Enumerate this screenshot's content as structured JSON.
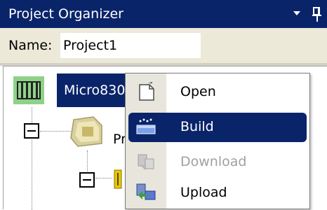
{
  "title_bar": {
    "title": "Project Organizer",
    "dropdown_icon": "chevron-down-icon",
    "pin_icon": "pin-icon"
  },
  "header": {
    "name_label": "Name:",
    "name_value": "Project1"
  },
  "tree": {
    "root": {
      "label": "Micro830",
      "icon": "controller-icon",
      "selected": true
    },
    "children": [
      {
        "label": "Pr",
        "icon": "programs-folder-icon",
        "expanded": true
      },
      {
        "label": "",
        "icon": "program-icon",
        "expanded": true
      }
    ]
  },
  "context_menu": {
    "items": [
      {
        "label": "Open",
        "icon": "open-document-icon",
        "state": "normal"
      },
      {
        "label": "Build",
        "icon": "build-icon",
        "state": "selected"
      },
      {
        "label": "Download",
        "icon": "download-icon",
        "state": "disabled"
      },
      {
        "label": "Upload",
        "icon": "upload-icon",
        "state": "normal"
      }
    ]
  },
  "colors": {
    "title_bar": "#0a246a",
    "header_bg": "#ece9d8",
    "selection": "#0a246a",
    "root_icon_bg": "#8ed28a",
    "disabled_text": "#a0a0a0"
  }
}
